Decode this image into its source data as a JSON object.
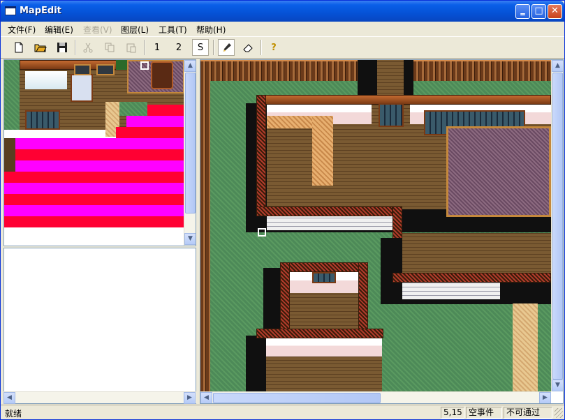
{
  "window": {
    "title": "MapEdit"
  },
  "menu": [
    {
      "label": "文件(F)",
      "enabled": true
    },
    {
      "label": "编辑(E)",
      "enabled": true
    },
    {
      "label": "查看(V)",
      "enabled": false
    },
    {
      "label": "图层(L)",
      "enabled": true
    },
    {
      "label": "工具(T)",
      "enabled": true
    },
    {
      "label": "帮助(H)",
      "enabled": true
    }
  ],
  "toolbar": {
    "icons": [
      "new-file-icon",
      "open-folder-icon",
      "save-disk-icon",
      "cut-icon",
      "copy-icon",
      "paste-icon",
      "pencil-icon",
      "eraser-icon",
      "help-icon"
    ],
    "layer1": "1",
    "layer2": "2",
    "layer_s": "S",
    "help_glyph": "?"
  },
  "status": {
    "text": "就绪",
    "coords": "5,15",
    "event": "空事件",
    "passability": "不可通过"
  },
  "colors": {
    "titlebar": "#0a5fe8",
    "magenta": "#ff00ff",
    "red": "#ff0033",
    "grass": "#4d8a58"
  }
}
